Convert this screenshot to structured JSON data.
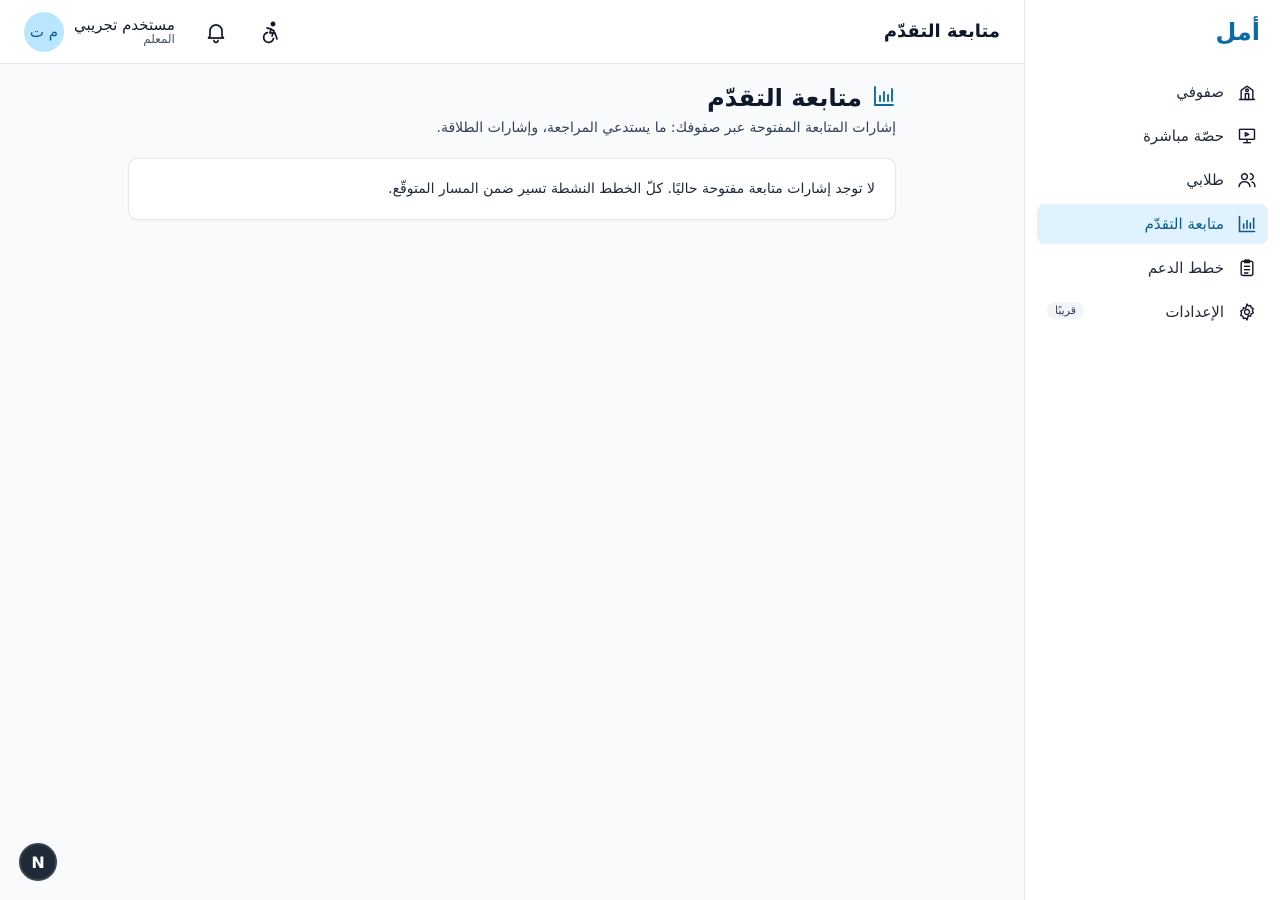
{
  "brand": {
    "name": "أمل",
    "color": "#0b6aa8"
  },
  "topbar": {
    "title": "متابعة التقدّم",
    "accessibility_icon": "accessibility-icon",
    "notifications_icon": "bell-icon",
    "user": {
      "name": "مستخدم تجريبي",
      "role": "المعلم",
      "initials": "م ت"
    }
  },
  "sidebar": {
    "items": [
      {
        "label": "صفوفي",
        "icon": "school-icon",
        "active": false
      },
      {
        "label": "حصّة مباشرة",
        "icon": "presentation-icon",
        "active": false
      },
      {
        "label": "طلابي",
        "icon": "users-icon",
        "active": false
      },
      {
        "label": "متابعة التقدّم",
        "icon": "bar-chart-icon",
        "active": true
      },
      {
        "label": "خطط الدعم",
        "icon": "clipboard-icon",
        "active": false
      },
      {
        "label": "الإعدادات",
        "icon": "gear-icon",
        "active": false,
        "badge": "قريبًا"
      }
    ]
  },
  "page": {
    "title": "متابعة التقدّم",
    "subtitle": "إشارات المتابعة المفتوحة عبر صفوفك: ما يستدعي المراجعة، وإشارات الطلاقة.",
    "empty_message": "لا توجد إشارات متابعة مفتوحة حاليًا. كلّ الخطط النشطة تسير ضمن المسار المتوقّع."
  },
  "fab": {
    "label": "N"
  },
  "colors": {
    "accent": "#0b6aa8",
    "active_bg": "#e0f2fe"
  }
}
